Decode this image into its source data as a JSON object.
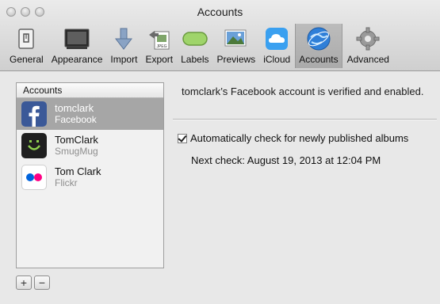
{
  "window": {
    "title": "Accounts"
  },
  "toolbar": {
    "items": [
      {
        "label": "General",
        "icon": "general-icon"
      },
      {
        "label": "Appearance",
        "icon": "appearance-icon"
      },
      {
        "label": "Import",
        "icon": "import-icon"
      },
      {
        "label": "Export",
        "icon": "export-icon"
      },
      {
        "label": "Labels",
        "icon": "labels-icon"
      },
      {
        "label": "Previews",
        "icon": "previews-icon"
      },
      {
        "label": "iCloud",
        "icon": "icloud-icon"
      },
      {
        "label": "Accounts",
        "icon": "accounts-icon",
        "selected": true
      },
      {
        "label": "Advanced",
        "icon": "advanced-icon"
      }
    ]
  },
  "accounts_list": {
    "header": "Accounts",
    "items": [
      {
        "name": "tomclark",
        "service": "Facebook",
        "icon": "facebook-icon",
        "selected": true
      },
      {
        "name": "TomClark",
        "service": "SmugMug",
        "icon": "smugmug-icon"
      },
      {
        "name": "Tom Clark",
        "service": "Flickr",
        "icon": "flickr-icon"
      }
    ],
    "add_label": "+",
    "remove_label": "−"
  },
  "detail": {
    "status": "tomclark’s Facebook account is verified and enabled.",
    "auto_check_label": "Automatically check for newly published albums",
    "auto_check_checked": true,
    "next_check": "Next check: August 19, 2013 at 12:04 PM"
  },
  "colors": {
    "selection": "#a6a6a6",
    "facebook": "#3b5998",
    "smugmug": "#1f1f1f",
    "flickr_blue": "#0063dc",
    "flickr_pink": "#ff0084"
  }
}
